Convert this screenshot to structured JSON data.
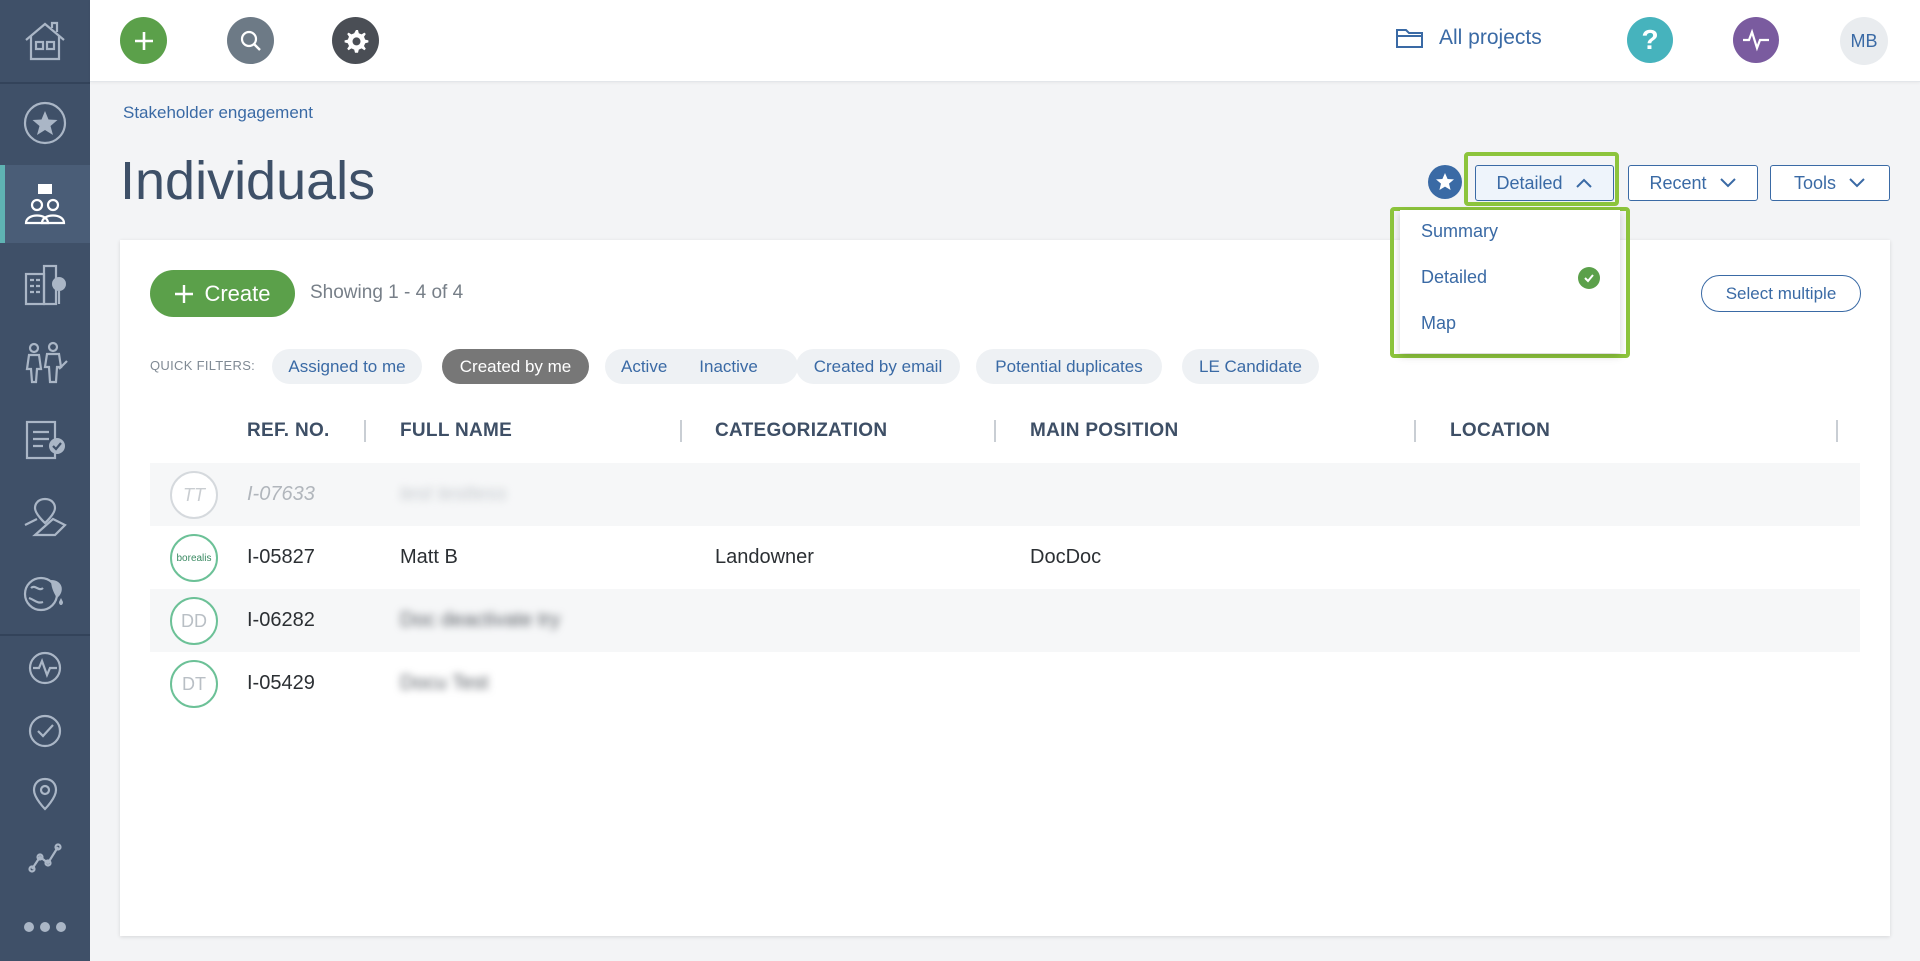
{
  "colors": {
    "sidebar": "#3f5068",
    "accent": "#3a6aa5",
    "green": "#5ba04a",
    "highlight": "#8cc43c"
  },
  "sidebar": {
    "items": [
      {
        "icon": "home-icon"
      },
      {
        "icon": "star-icon"
      },
      {
        "icon": "stakeholders-icon",
        "active": true
      },
      {
        "icon": "buildings-icon"
      },
      {
        "icon": "people-icon"
      },
      {
        "icon": "checklist-icon"
      },
      {
        "icon": "map-pin-region-icon"
      },
      {
        "icon": "environment-icon"
      },
      {
        "icon": "activity-icon"
      },
      {
        "icon": "check-circle-icon"
      },
      {
        "icon": "location-icon"
      },
      {
        "icon": "graph-icon"
      },
      {
        "icon": "more-icon"
      }
    ]
  },
  "topbar": {
    "all_projects": "All projects",
    "user_initials": "MB"
  },
  "header": {
    "breadcrumb": "Stakeholder engagement",
    "title": "Individuals",
    "view_button": "Detailed",
    "recent_button": "Recent",
    "tools_button": "Tools"
  },
  "view_menu": {
    "items": [
      "Summary",
      "Detailed",
      "Map"
    ],
    "selected": "Detailed"
  },
  "toolbar": {
    "create_label": "Create",
    "showing": "Showing 1 - 4 of 4",
    "select_multiple": "Select multiple"
  },
  "quick_filters": {
    "label": "QUICK FILTERS:",
    "items": [
      "Assigned to me",
      "Created by me",
      "Active",
      "Inactive",
      "Created by email",
      "Potential duplicates",
      "LE Candidate"
    ],
    "active": "Created by me"
  },
  "table": {
    "columns": [
      "REF. NO.",
      "FULL NAME",
      "CATEGORIZATION",
      "MAIN POSITION",
      "LOCATION"
    ],
    "rows": [
      {
        "initials": "TT",
        "ref": "I-07633",
        "name": "test testtess",
        "category": "",
        "position": "",
        "location": "",
        "inactive": true
      },
      {
        "initials": "borealis",
        "ref": "I-05827",
        "name": "Matt B",
        "category": "Landowner",
        "position": "DocDoc",
        "location": ""
      },
      {
        "initials": "DD",
        "ref": "I-06282",
        "name": "Doc deactivate try",
        "category": "",
        "position": "",
        "location": ""
      },
      {
        "initials": "DT",
        "ref": "I-05429",
        "name": "Docu Test",
        "category": "",
        "position": "",
        "location": ""
      }
    ]
  }
}
